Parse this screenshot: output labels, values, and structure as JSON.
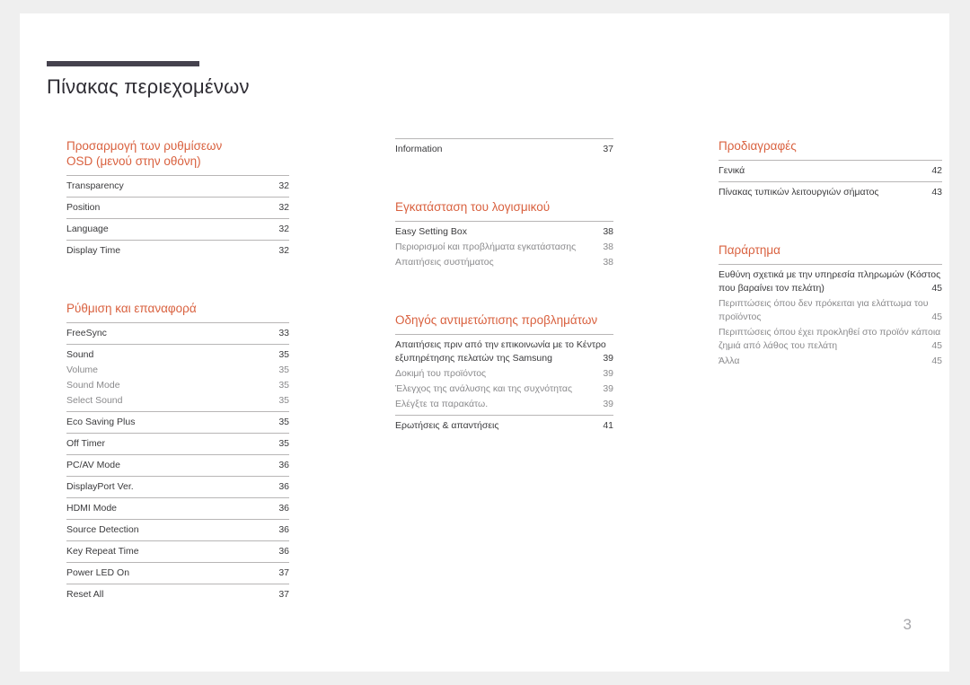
{
  "document": {
    "title": "Πίνακας περιεχομένων",
    "page_number": "3",
    "accent_color": "#d9613f",
    "rule_color": "#b8b6b6",
    "title_bar_color": "#45424e"
  },
  "columns": {
    "left": {
      "sections": [
        {
          "heading": "Προσαρμογή των ρυθμίσεων\nOSD (μενού στην οθόνη)",
          "groups": [
            {
              "rows": [
                {
                  "label": "Transparency",
                  "page": "32",
                  "level": "main"
                }
              ]
            },
            {
              "rows": [
                {
                  "label": "Position",
                  "page": "32",
                  "level": "main"
                }
              ]
            },
            {
              "rows": [
                {
                  "label": "Language",
                  "page": "32",
                  "level": "main"
                }
              ]
            },
            {
              "rows": [
                {
                  "label": "Display Time",
                  "page": "32",
                  "level": "main"
                }
              ]
            }
          ]
        },
        {
          "heading": "Ρύθμιση και επαναφορά",
          "groups": [
            {
              "rows": [
                {
                  "label": "FreeSync",
                  "page": "33",
                  "level": "main"
                }
              ]
            },
            {
              "rows": [
                {
                  "label": "Sound",
                  "page": "35",
                  "level": "main"
                },
                {
                  "label": "Volume",
                  "page": "35",
                  "level": "sub"
                },
                {
                  "label": "Sound Mode",
                  "page": "35",
                  "level": "sub"
                },
                {
                  "label": "Select Sound",
                  "page": "35",
                  "level": "sub"
                }
              ]
            },
            {
              "rows": [
                {
                  "label": "Eco Saving Plus",
                  "page": "35",
                  "level": "main"
                }
              ]
            },
            {
              "rows": [
                {
                  "label": "Off Timer",
                  "page": "35",
                  "level": "main"
                }
              ]
            },
            {
              "rows": [
                {
                  "label": "PC/AV Mode",
                  "page": "36",
                  "level": "main"
                }
              ]
            },
            {
              "rows": [
                {
                  "label": "DisplayPort Ver.",
                  "page": "36",
                  "level": "main"
                }
              ]
            },
            {
              "rows": [
                {
                  "label": "HDMI Mode",
                  "page": "36",
                  "level": "main"
                }
              ]
            },
            {
              "rows": [
                {
                  "label": "Source Detection",
                  "page": "36",
                  "level": "main"
                }
              ]
            },
            {
              "rows": [
                {
                  "label": "Key Repeat Time",
                  "page": "36",
                  "level": "main"
                }
              ]
            },
            {
              "rows": [
                {
                  "label": "Power LED On",
                  "page": "37",
                  "level": "main"
                }
              ]
            },
            {
              "rows": [
                {
                  "label": "Reset All",
                  "page": "37",
                  "level": "main"
                }
              ]
            }
          ]
        }
      ]
    },
    "middle": {
      "sections": [
        {
          "heading": "",
          "groups": [
            {
              "rows": [
                {
                  "label": "Information",
                  "page": "37",
                  "level": "main"
                }
              ]
            }
          ]
        },
        {
          "heading": "Εγκατάσταση του λογισμικού",
          "groups": [
            {
              "rows": [
                {
                  "label": "Easy Setting Box",
                  "page": "38",
                  "level": "main"
                },
                {
                  "label": "Περιορισμοί και προβλήματα εγκατάστασης",
                  "page": "38",
                  "level": "sub"
                },
                {
                  "label": "Απαιτήσεις συστήματος",
                  "page": "38",
                  "level": "sub"
                }
              ]
            }
          ]
        },
        {
          "heading": "Οδηγός αντιμετώπισης προβλημάτων",
          "groups": [
            {
              "rows": [
                {
                  "label": "Απαιτήσεις πριν από την επικοινωνία με το Κέντρο εξυπηρέτησης πελατών της Samsung",
                  "page": "39",
                  "level": "main",
                  "wrapped": true
                },
                {
                  "label": "Δοκιμή του προϊόντος",
                  "page": "39",
                  "level": "sub"
                },
                {
                  "label": "Έλεγχος της ανάλυσης και της συχνότητας",
                  "page": "39",
                  "level": "sub"
                },
                {
                  "label": "Ελέγξτε τα παρακάτω.",
                  "page": "39",
                  "level": "sub"
                }
              ]
            },
            {
              "rows": [
                {
                  "label": "Ερωτήσεις & απαντήσεις",
                  "page": "41",
                  "level": "main"
                }
              ]
            }
          ]
        }
      ]
    },
    "right": {
      "sections": [
        {
          "heading": "Προδιαγραφές",
          "groups": [
            {
              "rows": [
                {
                  "label": "Γενικά",
                  "page": "42",
                  "level": "main"
                }
              ]
            },
            {
              "rows": [
                {
                  "label": "Πίνακας τυπικών λειτουργιών σήματος",
                  "page": "43",
                  "level": "main"
                }
              ]
            }
          ]
        },
        {
          "heading": "Παράρτημα",
          "groups": [
            {
              "rows": [
                {
                  "label": "Ευθύνη σχετικά με την υπηρεσία πληρωμών (Κόστος που βαραίνει τον πελάτη)",
                  "page": "45",
                  "level": "main",
                  "wrapped": true
                },
                {
                  "label": "Περιπτώσεις όπου δεν πρόκειται για ελάττωμα του προϊόντος",
                  "page": "45",
                  "level": "sub",
                  "wrapped": true
                },
                {
                  "label": "Περιπτώσεις όπου έχει προκληθεί στο προϊόν κάποια ζημιά από λάθος του πελάτη",
                  "page": "45",
                  "level": "sub",
                  "wrapped": true
                },
                {
                  "label": "Άλλα",
                  "page": "45",
                  "level": "sub"
                }
              ]
            }
          ]
        }
      ]
    }
  }
}
